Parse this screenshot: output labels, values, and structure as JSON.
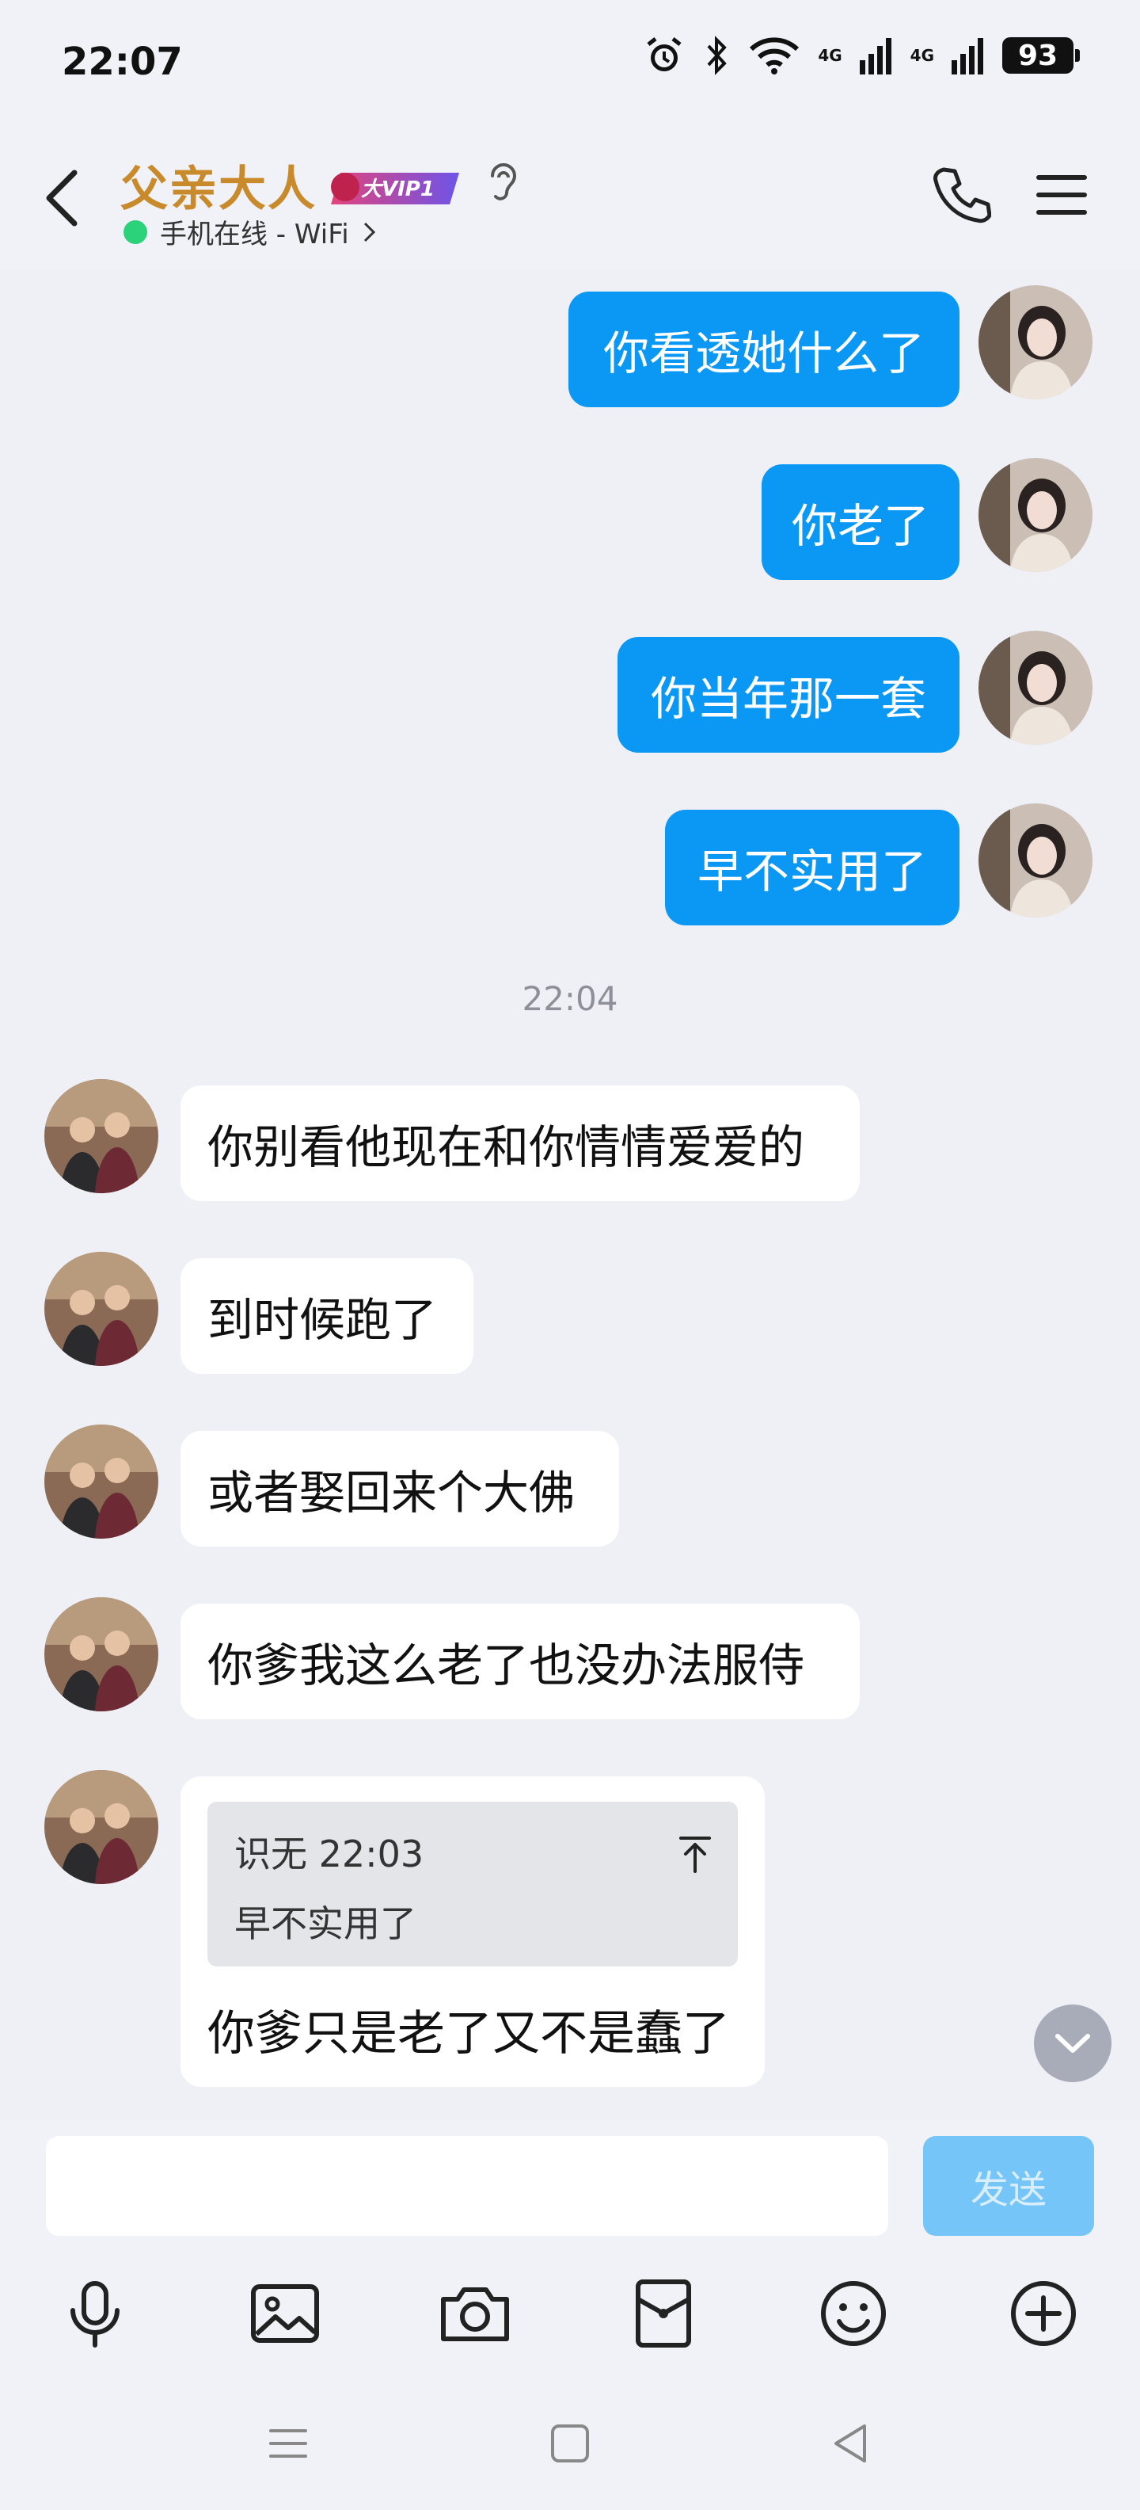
{
  "status_bar": {
    "time": "22:07",
    "network_1": "4G",
    "network_2": "4G",
    "battery": "93",
    "icons": [
      "alarm-icon",
      "bluetooth-icon",
      "wifi-icon",
      "signal-icon",
      "signal-icon",
      "battery-icon"
    ]
  },
  "header": {
    "title": "父亲大人",
    "vip_badge": "大VIP1",
    "status": "手机在线 - WiFi",
    "status_color": "#2bd27a"
  },
  "messages": {
    "outgoing": [
      "你看透她什么了",
      "你老了",
      "你当年那一套",
      "早不实用了"
    ],
    "timestamp": "22:04",
    "incoming": [
      "你别看他现在和你情情爱爱的",
      "到时候跑了",
      "或者娶回来个大佛",
      "你爹我这么老了也没办法服侍"
    ],
    "quote": {
      "meta": "识无 22:03",
      "text": "早不实用了",
      "reply": "你爹只是老了又不是蠢了"
    }
  },
  "input": {
    "value": "",
    "send_label": "发送"
  },
  "toolbar": {
    "items": [
      "microphone-icon",
      "image-icon",
      "camera-icon",
      "red-packet-icon",
      "emoji-icon",
      "plus-icon"
    ]
  },
  "colors": {
    "outgoing_bubble": "#0b98f4",
    "title": "#c98a2b",
    "send_button": "#76c5f8"
  }
}
